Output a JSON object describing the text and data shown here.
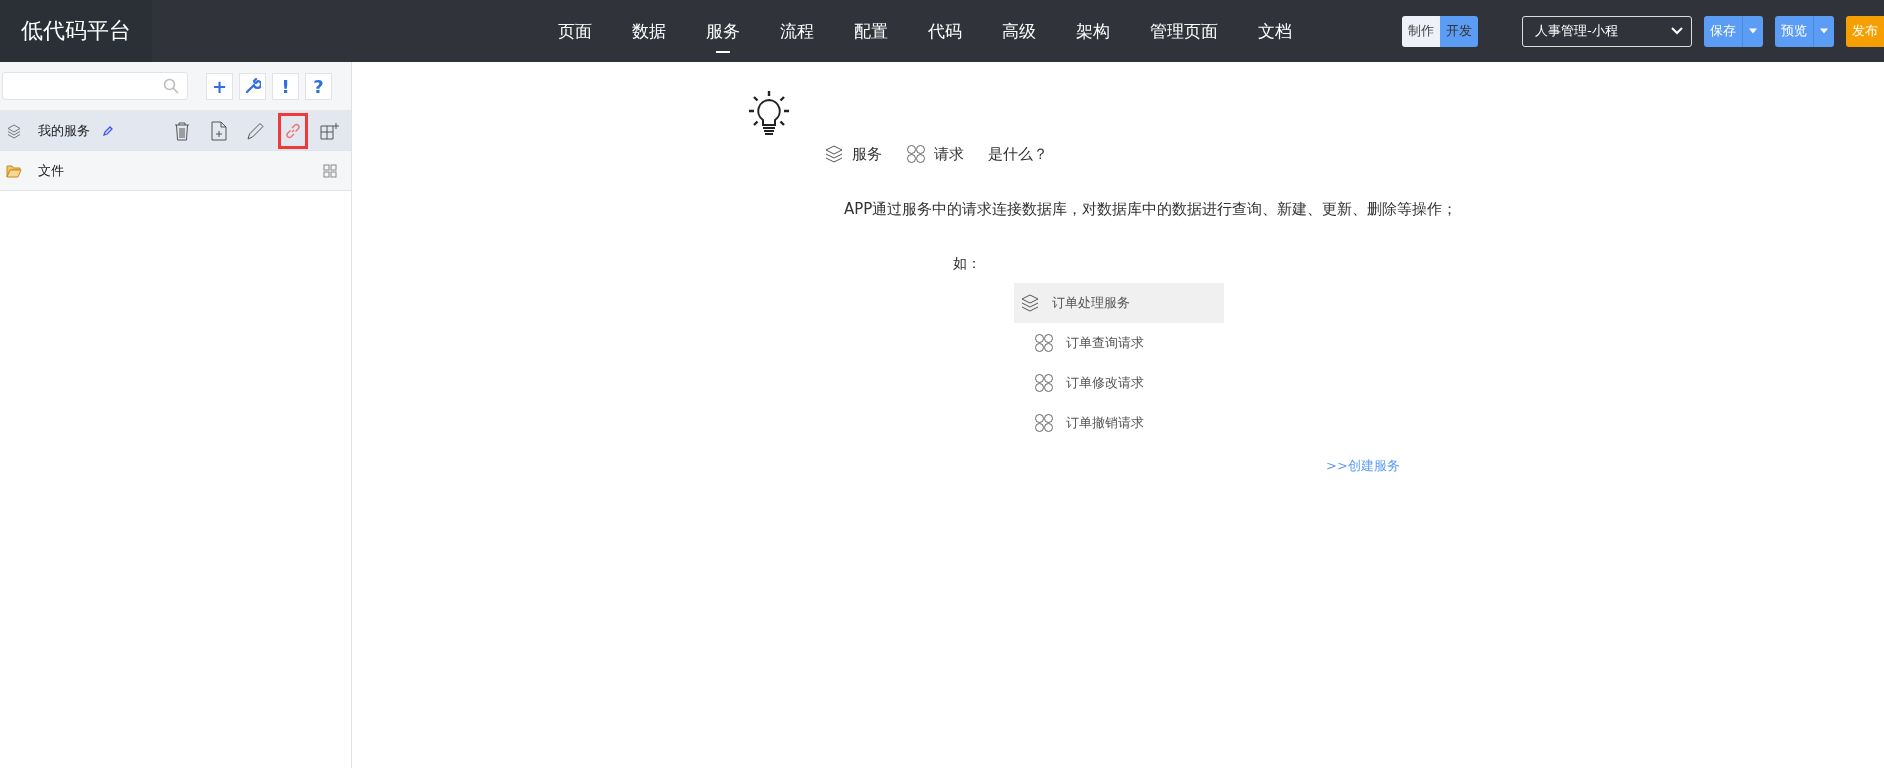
{
  "header": {
    "logo": "低代码平台",
    "nav": [
      {
        "label": "页面",
        "selected": false
      },
      {
        "label": "数据",
        "selected": false
      },
      {
        "label": "服务",
        "selected": true
      },
      {
        "label": "流程",
        "selected": false
      },
      {
        "label": "配置",
        "selected": false
      },
      {
        "label": "代码",
        "selected": false
      },
      {
        "label": "高级",
        "selected": false
      },
      {
        "label": "架构",
        "selected": false
      },
      {
        "label": "管理页面",
        "selected": false
      },
      {
        "label": "文档",
        "selected": false
      }
    ],
    "mode": [
      {
        "label": "制作",
        "selected": false
      },
      {
        "label": "开发",
        "selected": true
      }
    ],
    "app_select": {
      "value": "人事管理-小程"
    },
    "save": "保存",
    "preview": "预览",
    "publish": "发布"
  },
  "sidebar": {
    "tools": [
      {
        "kind": "add",
        "label": "+"
      },
      {
        "kind": "wrench"
      },
      {
        "kind": "alert",
        "label": "!"
      },
      {
        "kind": "help",
        "label": "?"
      }
    ],
    "items": [
      {
        "kind": "service",
        "label": "我的服务",
        "selected": true,
        "actions": [
          {
            "kind": "trash",
            "highlighted": false
          },
          {
            "kind": "add-file",
            "highlighted": false
          },
          {
            "kind": "pencil",
            "highlighted": false
          },
          {
            "kind": "link",
            "highlighted": true
          },
          {
            "kind": "table-add",
            "highlighted": false
          }
        ]
      },
      {
        "kind": "folder",
        "label": "文件",
        "selected": false,
        "actions": [
          {
            "kind": "grid",
            "highlighted": false
          }
        ]
      }
    ]
  },
  "intro": {
    "terms": [
      {
        "kind": "service",
        "label": "服务"
      },
      {
        "kind": "request",
        "label": "请求"
      }
    ],
    "question": "是什么？",
    "description": "APP通过服务中的请求连接数据库，对数据库中的数据进行查询、新建、更新、删除等操作；",
    "example_label": "如：",
    "example": [
      {
        "kind": "service",
        "label": "订单处理服务"
      },
      {
        "kind": "request",
        "label": "订单查询请求"
      },
      {
        "kind": "request",
        "label": "订单修改请求"
      },
      {
        "kind": "request",
        "label": "订单撤销请求"
      }
    ],
    "create_link": ">>创建服务"
  }
}
